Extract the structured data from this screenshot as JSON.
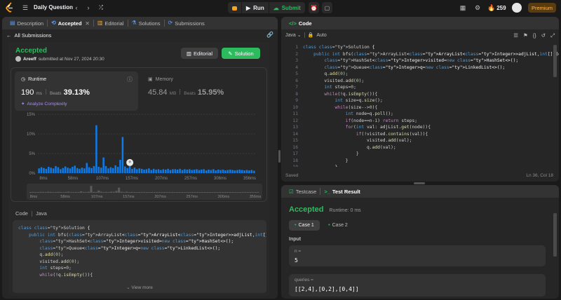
{
  "topbar": {
    "problem_list_label": "Daily Question",
    "run_label": "Run",
    "submit_label": "Submit",
    "streak": "259",
    "premium_label": "Premium"
  },
  "left": {
    "tabs": [
      {
        "label": "Description"
      },
      {
        "label": "Accepted"
      },
      {
        "label": "Editorial"
      },
      {
        "label": "Solutions"
      },
      {
        "label": "Submissions"
      }
    ],
    "back_label": "All Submissions",
    "status": "Accepted",
    "user": "Areeff",
    "submitted_text": "submitted at Nov 27, 2024 20:30",
    "editorial_btn": "Editorial",
    "solution_btn": "Solution",
    "runtime": {
      "title": "Runtime",
      "value": "190",
      "unit": "ms",
      "beats_label": "Beats",
      "beats": "39.13%",
      "analyze": "Analyze Complexity"
    },
    "memory": {
      "title": "Memory",
      "value": "45.84",
      "unit": "MB",
      "beats_label": "Beats",
      "beats": "15.95%"
    },
    "code_label": "Code",
    "lang_label": "Java",
    "view_more": "View more"
  },
  "chart_data": {
    "type": "bar",
    "y_ticks": [
      "15%",
      "10%",
      "5%",
      "0%"
    ],
    "ylim": [
      0,
      15
    ],
    "x_ticks": [
      "8ms",
      "58ms",
      "107ms",
      "157ms",
      "207ms",
      "257ms",
      "306ms",
      "356ms"
    ],
    "mini_ticks": [
      "8ms",
      "58ms",
      "107ms",
      "157ms",
      "207ms",
      "257ms",
      "306ms",
      "356ms"
    ],
    "values": [
      1.2,
      1.5,
      1.3,
      1.1,
      1.6,
      1.4,
      1.2,
      1.8,
      1.5,
      1.0,
      1.3,
      1.7,
      1.4,
      1.2,
      1.6,
      1.9,
      1.3,
      1.1,
      1.4,
      1.2,
      2.6,
      1.5,
      1.3,
      1.8,
      12.2,
      1.6,
      1.4,
      4.0,
      1.8,
      1.2,
      1.5,
      1.3,
      2.0,
      1.6,
      3.4,
      9.2,
      1.7,
      1.3,
      1.8,
      1.1,
      1.4,
      1.0,
      1.2,
      1.1,
      0.9,
      1.0,
      1.2,
      0.8,
      1.1,
      0.9,
      1.0,
      0.8,
      1.0,
      0.9,
      1.1,
      0.8,
      1.0,
      1.0,
      0.9,
      1.1,
      0.8,
      1.0,
      0.9,
      1.0,
      0.8,
      0.9,
      1.0,
      0.8,
      0.9,
      1.0,
      0.7,
      0.9,
      0.8,
      1.0,
      0.7,
      0.9,
      0.8,
      0.9,
      0.7,
      0.8,
      0.9,
      0.8,
      0.7,
      0.8,
      0.9,
      0.8,
      0.7,
      0.8,
      0.7,
      0.8,
      0.6
    ],
    "highlight_index": 38
  },
  "left_code": [
    "class Solution {",
    "    public int bfs(ArrayList<ArrayList<Integer>>adjList,int[][]queries,int n){",
    "        HashSet<Integer>visited=new HashSet<>();",
    "        Queue<Integer>q=new LinkedList<>();",
    "        q.add(0);",
    "        visited.add(0);",
    "        int steps=0;",
    "        while(!q.isEmpty()){"
  ],
  "editor": {
    "title": "Code",
    "lang": "Java",
    "mode": "Auto",
    "saved": "Saved",
    "cursor": "Ln 36, Col 18",
    "line_numbers": [
      "1",
      "2",
      "3",
      "4",
      "5",
      "6",
      "7",
      "8",
      "9",
      "10",
      "11",
      "12",
      "13",
      "14",
      "15",
      "16",
      "17",
      "18",
      "19"
    ],
    "lines": [
      "class Solution {",
      "    public int bfs(ArrayList<ArrayList<Integer>>adjList,int[][]queries,int n){",
      "        HashSet<Integer>visited=new HashSet<>();",
      "        Queue<Integer>q=new LinkedList<>();",
      "        q.add(0);",
      "        visited.add(0);",
      "        int steps=0;",
      "        while(!q.isEmpty()){",
      "            int size=q.size();",
      "            while(size-->0){",
      "                int node=q.poll();",
      "                if(node==n-1) return steps;",
      "                for(int val: adjList.get(node)){",
      "                    if(!visited.contains(val)){",
      "                        visited.add(val);",
      "                        q.add(val);",
      "                    }",
      "                }",
      "            }"
    ]
  },
  "bottom": {
    "tab_testcase": "Testcase",
    "tab_result": "Test Result",
    "status": "Accepted",
    "runtime": "Runtime: 0 ms",
    "case1": "Case 1",
    "case2": "Case 2",
    "input_label": "Input",
    "n_label": "n =",
    "n_value": "5",
    "q_label": "queries =",
    "q_value": "[[2,4],[0,2],[0,4]]"
  }
}
